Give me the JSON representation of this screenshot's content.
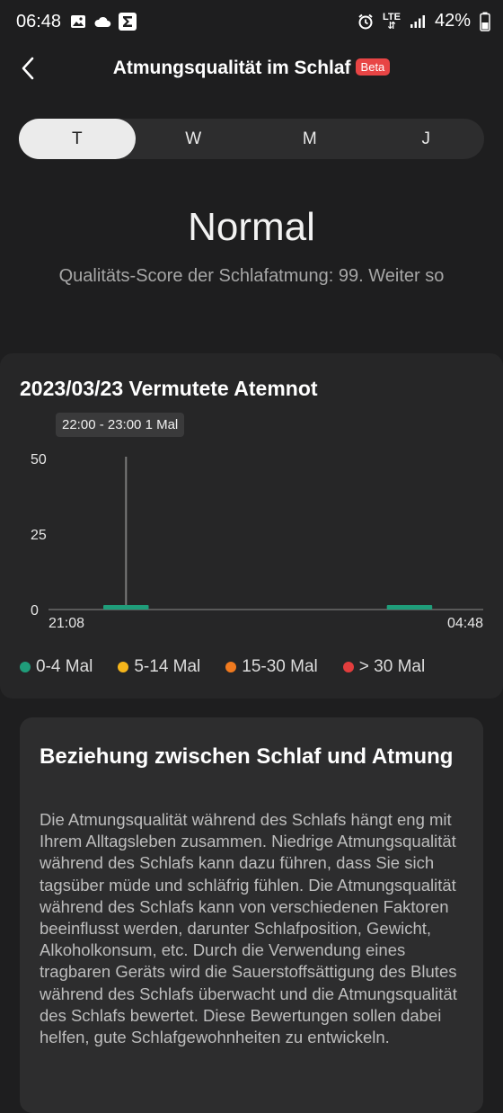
{
  "status_bar": {
    "time": "06:48",
    "network": "LTE",
    "battery": "42%",
    "icons_left": [
      "image-icon",
      "cloud-icon",
      "sigma-icon"
    ],
    "icons_right": [
      "alarm-icon",
      "lte-icon",
      "signal-icon",
      "battery-icon"
    ]
  },
  "header": {
    "title": "Atmungsqualität im Schlaf",
    "badge": "Beta",
    "back_icon": "chevron-left-icon"
  },
  "tabs": [
    {
      "label": "T",
      "active": true
    },
    {
      "label": "W",
      "active": false
    },
    {
      "label": "M",
      "active": false
    },
    {
      "label": "J",
      "active": false
    }
  ],
  "status": {
    "headline": "Normal",
    "subtitle": "Qualitäts-Score der Schlafatmung: 99. Weiter so"
  },
  "chart_card": {
    "title": "2023/03/23 Vermutete Atemnot",
    "tooltip": "22:00 - 23:00 1 Mal"
  },
  "chart_data": {
    "type": "bar",
    "title": "2023/03/23 Vermutete Atemnot",
    "x_start_label": "21:08",
    "x_end_label": "04:48",
    "y_ticks": [
      "50",
      "25",
      "0"
    ],
    "ylim": [
      0,
      50
    ],
    "segments": [
      {
        "start": "22:00",
        "end": "23:00",
        "value": 1,
        "category": "0-4 Mal"
      },
      {
        "start": "03:00",
        "end": "04:00",
        "value": 1,
        "category": "0-4 Mal"
      }
    ],
    "selected": {
      "label": "22:00 - 23:00 1 Mal"
    },
    "legend": [
      {
        "label": "0-4 Mal",
        "color": "#1f9d7a"
      },
      {
        "label": "5-14 Mal",
        "color": "#f5b51b"
      },
      {
        "label": "15-30 Mal",
        "color": "#f07a1f"
      },
      {
        "label": "> 30 Mal",
        "color": "#e23d3d"
      }
    ]
  },
  "info": {
    "title": "Beziehung zwischen Schlaf und Atmung",
    "body": "Die Atmungsqualität während des Schlafs hängt eng mit Ihrem Alltagsleben zusammen. Niedrige Atmungsqualität während des Schlafs kann dazu führen, dass Sie sich tagsüber müde und schläfrig fühlen. Die Atmungsqualität während des Schlafs kann von verschiedenen Faktoren beeinflusst werden, darunter Schlafposition, Gewicht, Alkoholkonsum, etc. Durch die Verwendung eines tragbaren Geräts wird die Sauerstoffsättigung des Blutes während des Schlafs überwacht und die Atmungsqualität des Schlafs bewertet. Diese Bewertungen sollen dabei helfen, gute Schlafgewohnheiten zu entwickeln."
  }
}
